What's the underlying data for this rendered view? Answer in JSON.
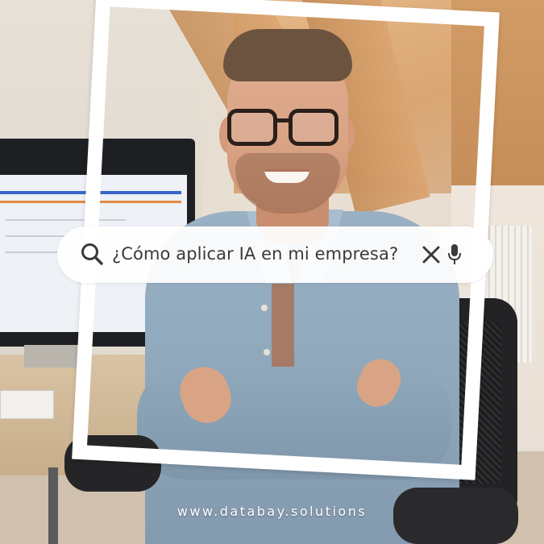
{
  "search": {
    "query": "¿Cómo aplicar IA en mi empresa?"
  },
  "footer": {
    "url": "www.databay.solutions"
  },
  "colors": {
    "frame": "#ffffff",
    "search_text": "#3a3a3a",
    "shirt": "#8ea7bb"
  },
  "icons": {
    "search": "search-icon",
    "clear": "close-icon",
    "voice": "microphone-icon"
  }
}
